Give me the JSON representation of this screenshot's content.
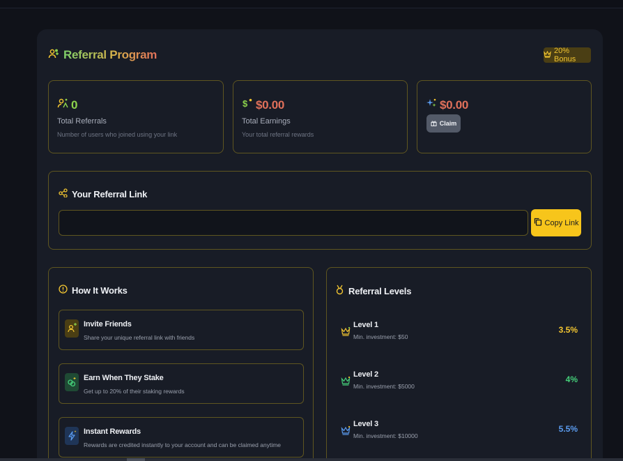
{
  "header": {
    "title": "Referral Program",
    "bonus": "20% Bonus"
  },
  "stats": [
    {
      "value": "0",
      "label": "Total Referrals",
      "desc": "Number of users who joined using your link",
      "color": "#8cd24c"
    },
    {
      "value": "$0.00",
      "label": "Total Earnings",
      "desc": "Your total referral rewards",
      "color": "#e0705a"
    },
    {
      "value": "$0.00",
      "claim_label": "Claim",
      "color": "#e0705a"
    }
  ],
  "referral_link": {
    "title": "Your Referral Link",
    "value": "",
    "copy_label": "Copy Link"
  },
  "how_it_works": {
    "title": "How It Works",
    "steps": [
      {
        "title": "Invite Friends",
        "desc": "Share your unique referral link with friends",
        "icon": "user-plus-icon"
      },
      {
        "title": "Earn When They Stake",
        "desc": "Get up to 20% of their staking rewards",
        "icon": "coins-icon"
      },
      {
        "title": "Instant Rewards",
        "desc": "Rewards are credited instantly to your account and can be claimed anytime",
        "icon": "lightning-icon"
      }
    ]
  },
  "levels": {
    "title": "Referral Levels",
    "items": [
      {
        "title": "Level 1",
        "min": "Min. investment: $50",
        "rate": "3.5%",
        "color": "#f2c531"
      },
      {
        "title": "Level 2",
        "min": "Min. investment: $5000",
        "rate": "4%",
        "color": "#45d07a"
      },
      {
        "title": "Level 3",
        "min": "Min. investment: $10000",
        "rate": "5.5%",
        "color": "#5b9cf0"
      }
    ]
  },
  "colors": {
    "accent": "#f7c51b",
    "border": "#5f5620",
    "panel": "#181c26",
    "background": "#101219"
  }
}
